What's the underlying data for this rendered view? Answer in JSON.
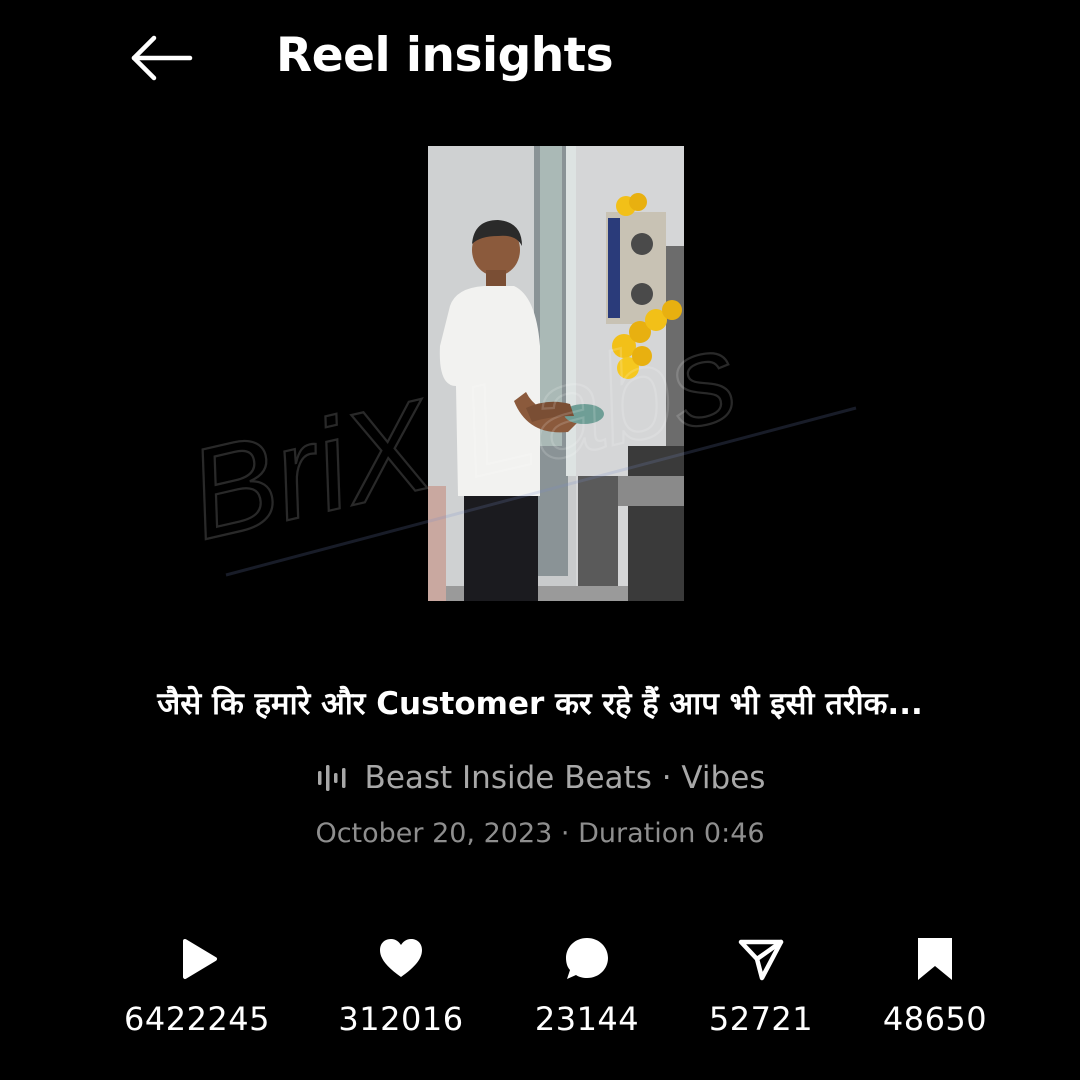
{
  "header": {
    "title": "Reel insights",
    "back_icon": "arrow-left-icon"
  },
  "thumbnail": {
    "alt": "Reel video thumbnail"
  },
  "watermark": {
    "text": "BriX Labs"
  },
  "reel": {
    "caption": "जैसे कि हमारे और Customer कर रहे हैं आप भी इसी तरीक...",
    "audio_icon": "audio-waveform-icon",
    "audio": "Beast Inside Beats · Vibes",
    "date": "October 20, 2023",
    "separator": " · ",
    "duration": "Duration 0:46"
  },
  "stats": [
    {
      "icon": "play-icon",
      "value": "6422245"
    },
    {
      "icon": "heart-icon",
      "value": "312016"
    },
    {
      "icon": "comment-icon",
      "value": "23144"
    },
    {
      "icon": "share-icon",
      "value": "52721"
    },
    {
      "icon": "bookmark-icon",
      "value": "48650"
    }
  ],
  "colors": {
    "background": "#000000",
    "text_primary": "#ffffff",
    "text_secondary": "#a8a8a8",
    "text_tertiary": "#8e8e8e"
  }
}
